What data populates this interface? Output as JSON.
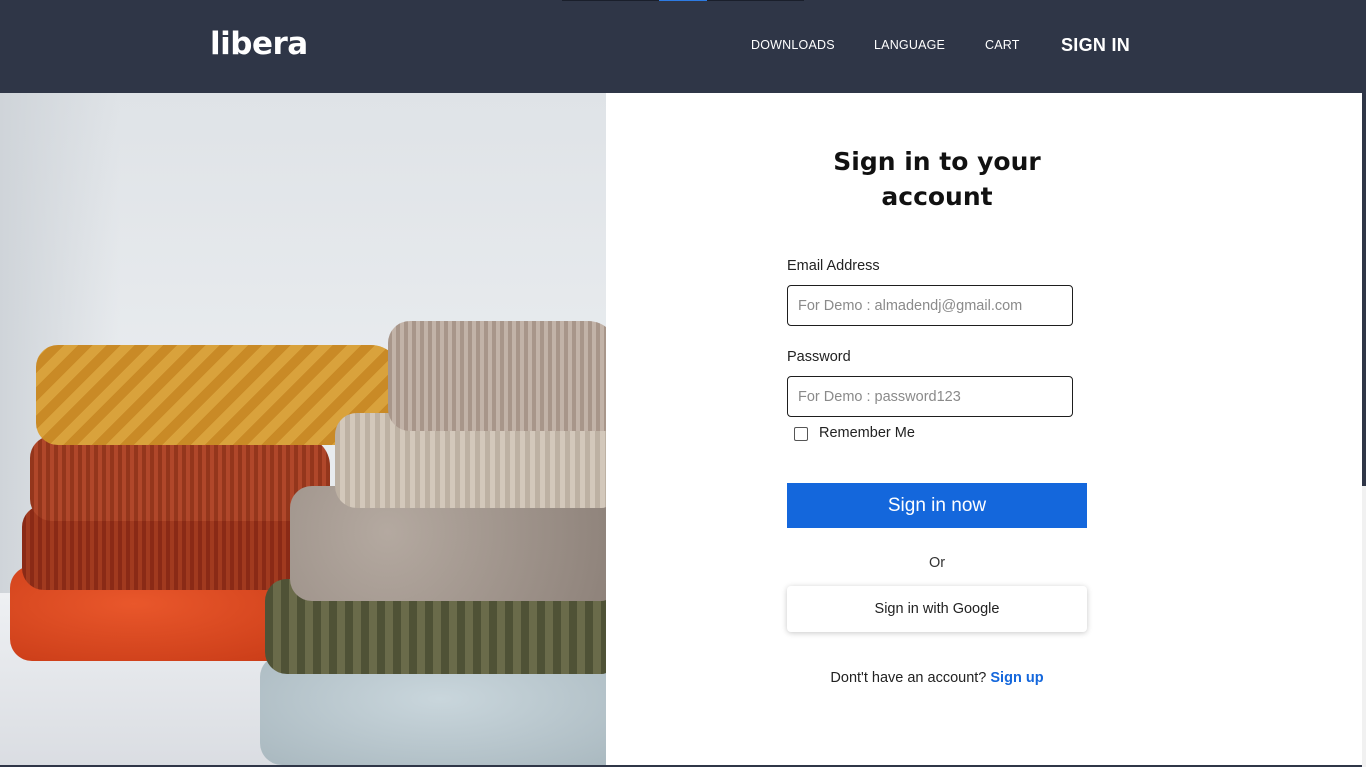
{
  "header": {
    "logo": "libera",
    "nav": {
      "downloads": "DOWNLOADS",
      "language": "LANGUAGE",
      "cart": "CART",
      "sign_in": "SIGN IN"
    }
  },
  "hero_image": {
    "subject": "stack of knitted sweaters"
  },
  "form": {
    "title": "Sign in to your account",
    "email_label": "Email Address",
    "email_placeholder": "For Demo : almadendj@gmail.com",
    "email_value": "",
    "password_label": "Password",
    "password_placeholder": "For Demo : password123",
    "password_value": "",
    "remember_label": "Remember Me",
    "remember_checked": false,
    "submit_label": "Sign in now",
    "or_text": "Or",
    "google_label": "Sign in with Google",
    "signup_prompt": "Dont't have an account?",
    "signup_link": "Sign up"
  },
  "colors": {
    "header_bg": "#2f3647",
    "primary": "#1467dc",
    "text": "#222222"
  }
}
